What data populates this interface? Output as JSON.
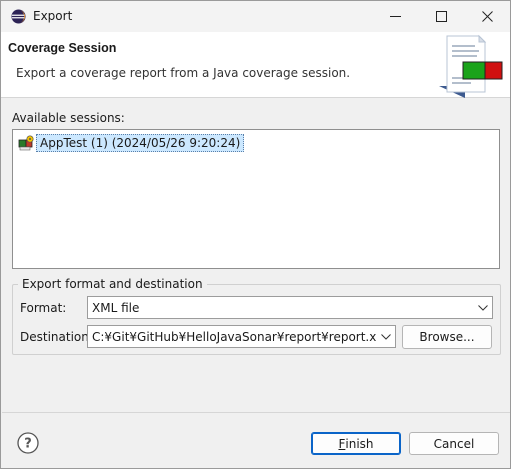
{
  "window": {
    "title": "Export"
  },
  "banner": {
    "title": "Coverage Session",
    "description": "Export a coverage report from a Java coverage session."
  },
  "sessions": {
    "label": "Available sessions:",
    "items": [
      {
        "label": "AppTest (1) (2024/05/26 9:20:24)",
        "selected": true
      }
    ]
  },
  "export_group": {
    "legend": "Export format and destination",
    "format_label": "Format:",
    "format_value": "XML file",
    "destination_label": "Destination:",
    "destination_value": "C:¥Git¥GitHub¥HelloJavaSonar¥report¥report.xml",
    "browse_label": "Browse..."
  },
  "footer": {
    "finish_first": "F",
    "finish_rest": "inish",
    "cancel_label": "Cancel"
  },
  "colors": {
    "accent": "#0a64c8",
    "selection": "#cce8ff"
  }
}
